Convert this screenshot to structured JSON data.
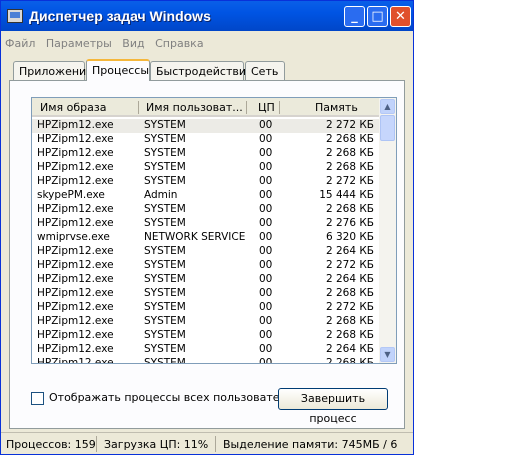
{
  "window": {
    "title": "Диспетчер задач Windows"
  },
  "menu": [
    "Файл",
    "Параметры",
    "Вид",
    "Справка"
  ],
  "tabs": [
    "Приложения",
    "Процессы",
    "Быстродействие",
    "Сеть"
  ],
  "active_tab": "Процессы",
  "columns": [
    "Имя образа",
    "Имя пользоват...",
    "ЦП",
    "Память"
  ],
  "processes": [
    {
      "name": "HPZipm12.exe",
      "user": "SYSTEM",
      "cpu": "00",
      "mem": "2 272 КБ"
    },
    {
      "name": "HPZipm12.exe",
      "user": "SYSTEM",
      "cpu": "00",
      "mem": "2 268 КБ"
    },
    {
      "name": "HPZipm12.exe",
      "user": "SYSTEM",
      "cpu": "00",
      "mem": "2 268 КБ"
    },
    {
      "name": "HPZipm12.exe",
      "user": "SYSTEM",
      "cpu": "00",
      "mem": "2 268 КБ"
    },
    {
      "name": "HPZipm12.exe",
      "user": "SYSTEM",
      "cpu": "00",
      "mem": "2 272 КБ"
    },
    {
      "name": "skypePM.exe",
      "user": "Admin",
      "cpu": "00",
      "mem": "15 444 КБ"
    },
    {
      "name": "HPZipm12.exe",
      "user": "SYSTEM",
      "cpu": "00",
      "mem": "2 268 КБ"
    },
    {
      "name": "HPZipm12.exe",
      "user": "SYSTEM",
      "cpu": "00",
      "mem": "2 276 КБ"
    },
    {
      "name": "wmiprvse.exe",
      "user": "NETWORK SERVICE",
      "cpu": "00",
      "mem": "6 320 КБ"
    },
    {
      "name": "HPZipm12.exe",
      "user": "SYSTEM",
      "cpu": "00",
      "mem": "2 264 КБ"
    },
    {
      "name": "HPZipm12.exe",
      "user": "SYSTEM",
      "cpu": "00",
      "mem": "2 272 КБ"
    },
    {
      "name": "HPZipm12.exe",
      "user": "SYSTEM",
      "cpu": "00",
      "mem": "2 264 КБ"
    },
    {
      "name": "HPZipm12.exe",
      "user": "SYSTEM",
      "cpu": "00",
      "mem": "2 268 КБ"
    },
    {
      "name": "HPZipm12.exe",
      "user": "SYSTEM",
      "cpu": "00",
      "mem": "2 272 КБ"
    },
    {
      "name": "HPZipm12.exe",
      "user": "SYSTEM",
      "cpu": "00",
      "mem": "2 268 КБ"
    },
    {
      "name": "HPZipm12.exe",
      "user": "SYSTEM",
      "cpu": "00",
      "mem": "2 268 КБ"
    },
    {
      "name": "HPZipm12.exe",
      "user": "SYSTEM",
      "cpu": "00",
      "mem": "2 264 КБ"
    },
    {
      "name": "HPZipm12.exe",
      "user": "SYSTEM",
      "cpu": "00",
      "mem": "2 268 КБ"
    },
    {
      "name": "HPZipm12.exe",
      "user": "SYSTEM",
      "cpu": "00",
      "mem": "2 268 КБ"
    }
  ],
  "show_all_label": "Отображать процессы всех пользователей",
  "end_process_label": "Завершить процесс",
  "status": {
    "processes": "Процессов: 159",
    "cpu": "Загрузка ЦП: 11%",
    "memory": "Выделение памяти: 745МБ / 6"
  },
  "icons": {
    "app": "task-manager-icon",
    "minimize": "minimize-icon",
    "maximize": "maximize-icon",
    "close": "close-icon",
    "scroll_up": "arrow-up-icon",
    "scroll_down": "arrow-down-icon"
  }
}
